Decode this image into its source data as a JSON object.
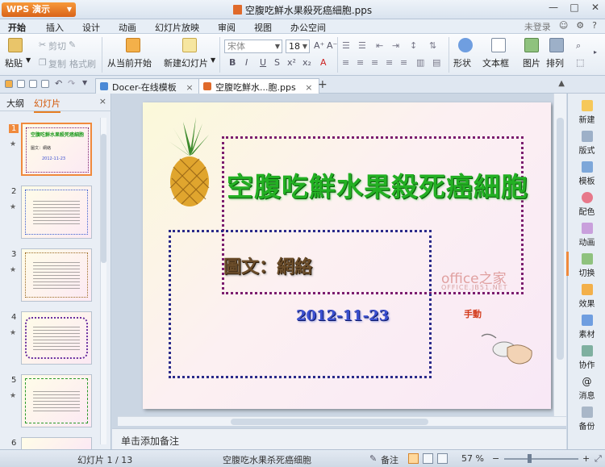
{
  "titlebar": {
    "app_button": "WPS 演示",
    "document_title": "空腹吃鮮水果殺死癌細胞.pps",
    "min": "—",
    "max": "□",
    "close": "✕"
  },
  "menu": {
    "tabs": [
      "开始",
      "插入",
      "设计",
      "动画",
      "幻灯片放映",
      "审阅",
      "视图",
      "办公空间"
    ],
    "login": "未登录"
  },
  "ribbon": {
    "paste": "粘贴",
    "cut": "剪切",
    "copy": "复制",
    "format_painter": "格式刷",
    "from_current": "从当前开始",
    "new_slide": "新建幻灯片",
    "font_name": "宋体",
    "font_size": "18",
    "bold": "B",
    "italic": "I",
    "underline": "U",
    "shape": "形状",
    "textbox": "文本框",
    "picture": "图片",
    "arrange": "排列"
  },
  "doc_tabs": [
    {
      "label": "Docer-在线模板",
      "active": false
    },
    {
      "label": "空腹吃鮮水...胞.pps",
      "active": true
    }
  ],
  "left_panel": {
    "tab_outline": "大纲",
    "tab_slides": "幻灯片",
    "close": "×",
    "thumbnails": [
      {
        "num": "1",
        "thumb_text": "空腹吃鮮水果殺死癌細胞",
        "thumb_sub": "圖文：網絡",
        "thumb_date": "2012-11-23"
      },
      {
        "num": "2"
      },
      {
        "num": "3"
      },
      {
        "num": "4"
      },
      {
        "num": "5"
      },
      {
        "num": "6"
      }
    ]
  },
  "slide": {
    "title": "空腹吃鮮水果殺死癌細胞",
    "author": "圖文：網絡",
    "date": "2012-11-23",
    "action": "手動",
    "watermark": "office之家",
    "watermark_sub": "OFFICE.JB51.NET"
  },
  "notes": {
    "placeholder": "单击添加备注"
  },
  "right_tools": [
    "新建",
    "版式",
    "模板",
    "配色",
    "动画",
    "切换",
    "效果",
    "素材",
    "协作",
    "消息",
    "备份"
  ],
  "status": {
    "slide_counter": "幻灯片 1 / 13",
    "doc_name": "空腹吃水果杀死癌细胞",
    "notes_label": "备注",
    "zoom": "57 %",
    "zoom_value": 57
  },
  "colors": {
    "accent": "#f08a3c",
    "title_green": "#23b023",
    "date_blue": "#3a4fd0",
    "frame_purple": "#7b1d6f"
  }
}
